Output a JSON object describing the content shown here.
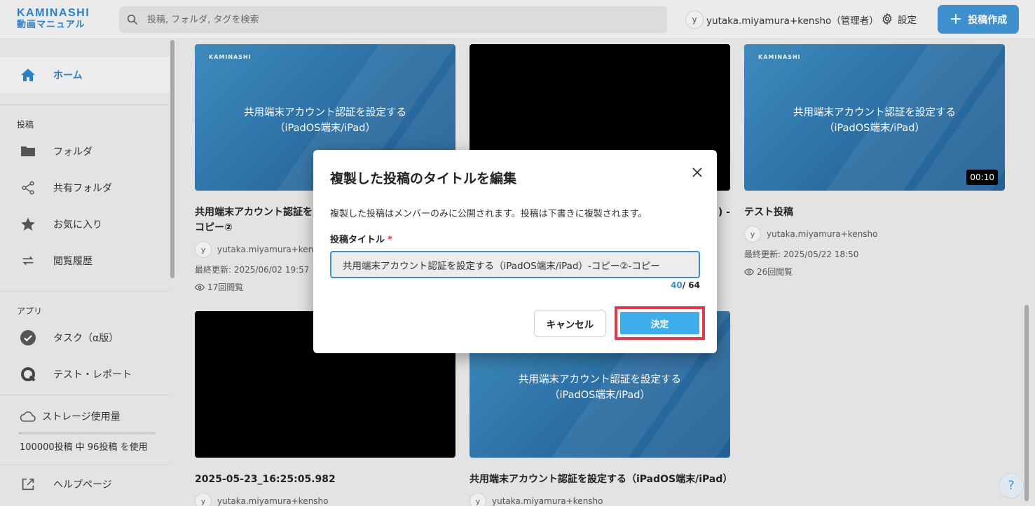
{
  "header": {
    "logo_top": "KAMINASHI",
    "logo_sub": "動画マニュアル",
    "search_placeholder": "投稿, フォルダ, タグを検索",
    "user_initial": "y",
    "user_name": "yutaka.miyamura+kensho（管理者）",
    "settings_label": "設定",
    "create_label": "投稿作成"
  },
  "sidebar": {
    "home_label": "ホーム",
    "section_posts": "投稿",
    "items_posts": [
      {
        "label": "フォルダ",
        "icon": "folder-icon"
      },
      {
        "label": "共有フォルダ",
        "icon": "share-icon"
      },
      {
        "label": "お気に入り",
        "icon": "star-icon"
      },
      {
        "label": "閲覧履歴",
        "icon": "history-icon"
      }
    ],
    "section_apps": "アプリ",
    "items_apps": [
      {
        "label": "タスク（α版）",
        "icon": "task-check-icon"
      },
      {
        "label": "テスト・レポート",
        "icon": "q-icon"
      }
    ],
    "storage_title": "ストレージ使用量",
    "storage_text": "100000投稿 中 96投稿 を使用",
    "storage_used_fraction": 0.00096,
    "help_label": "ヘルプページ"
  },
  "cards": [
    {
      "title": "共用端末アカウント認証を",
      "title2": "コピー②",
      "thumb": "brand",
      "thumb_line1": "共用端末アカウント認証を設定する",
      "thumb_line2": "（iPadOS端末/iPad）",
      "brand_text": "KAMINASHI",
      "user": "yutaka.miyamura+kensho",
      "updated": "最終更新: 2025/06/02 19:57",
      "views": "17回閲覧"
    },
    {
      "title": ") -",
      "thumb": "black"
    },
    {
      "title": "テスト投稿",
      "thumb": "brand",
      "thumb_line1": "共用端末アカウント認証を設定する",
      "thumb_line2": "（iPadOS端末/iPad）",
      "brand_text": "KAMINASHI",
      "duration": "00:10",
      "user": "yutaka.miyamura+kensho",
      "updated": "最終更新: 2025/05/22 18:50",
      "views": "26回閲覧"
    },
    {
      "title": "2025-05-23_16:25:05.982",
      "thumb": "black",
      "user": "yutaka.miyamura+kensho"
    },
    {
      "title": "共用端末アカウント認証を設定する（iPadOS端末/iPad）",
      "thumb": "brand",
      "thumb_line1": "共用端末アカウント認証を設定する",
      "thumb_line2": "（iPadOS端末/iPad）",
      "user": "yutaka.miyamura+kensho"
    }
  ],
  "dialog": {
    "title": "複製した投稿のタイトルを編集",
    "description": "複製した投稿はメンバーのみに公開されます。投稿は下書きに複製されます。",
    "field_label": "投稿タイトル",
    "required_mark": "*",
    "input_value": "共用端末アカウント認証を設定する（iPadOS端末/iPad）-コピー②-コピー",
    "counter_current": "40",
    "counter_max": "/ 64",
    "cancel_label": "キャンセル",
    "confirm_label": "決定"
  },
  "help_button": "?",
  "colors": {
    "accent": "#3d8fcd",
    "confirm": "#3daee9",
    "highlight_border": "#e03b4b",
    "required": "#d23b3b"
  }
}
